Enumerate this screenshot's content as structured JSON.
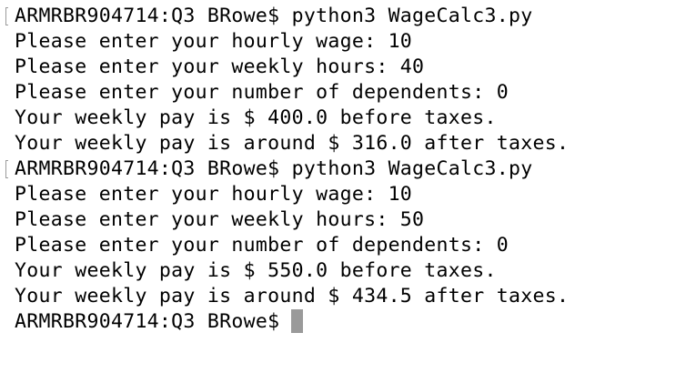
{
  "terminal": {
    "lines": [
      "ARMRBR904714:Q3 BRowe$ python3 WageCalc3.py",
      "Please enter your hourly wage: 10",
      "Please enter your weekly hours: 40",
      "Please enter your number of dependents: 0",
      "Your weekly pay is $ 400.0 before taxes.",
      "Your weekly pay is around $ 316.0 after taxes.",
      "ARMRBR904714:Q3 BRowe$ python3 WageCalc3.py",
      "Please enter your hourly wage: 10",
      "Please enter your weekly hours: 50",
      "Please enter your number of dependents: 0",
      "Your weekly pay is $ 550.0 before taxes.",
      "Your weekly pay is around $ 434.5 after taxes.",
      "ARMRBR904714:Q3 BRowe$"
    ]
  }
}
